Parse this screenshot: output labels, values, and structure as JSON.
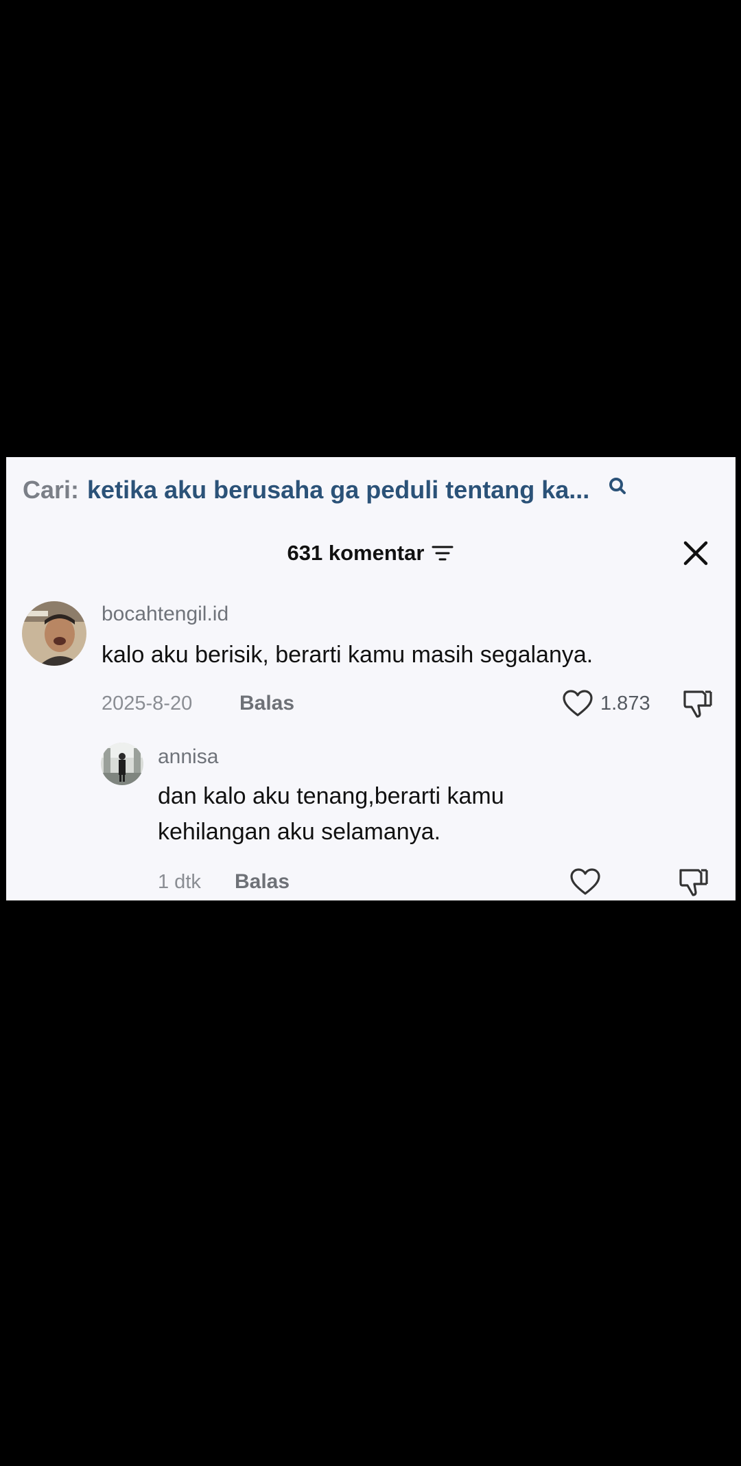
{
  "search": {
    "prefix": "Cari:",
    "query": "ketika aku berusaha ga peduli tentang ka..."
  },
  "header": {
    "count_label": "631 komentar"
  },
  "comments": [
    {
      "username": "bocahtengil.id",
      "text": "kalo aku berisik, berarti kamu masih segalanya.",
      "date": "2025-8-20",
      "reply_label": "Balas",
      "likes": "1.873"
    }
  ],
  "replies": [
    {
      "username": "annisa",
      "text_line1": "dan kalo aku tenang,berarti kamu",
      "text_line2": "kehilangan aku selamanya.",
      "date": "1 dtk",
      "reply_label": "Balas"
    }
  ],
  "icons": {
    "search": "search-icon",
    "filter": "filter-icon",
    "close": "close-icon",
    "like": "heart-icon",
    "dislike": "thumbs-down-icon"
  },
  "colors": {
    "panel_bg": "#f7f7fb",
    "search_query": "#2b5278",
    "text_primary": "#111111",
    "text_secondary": "#8a8d93"
  }
}
